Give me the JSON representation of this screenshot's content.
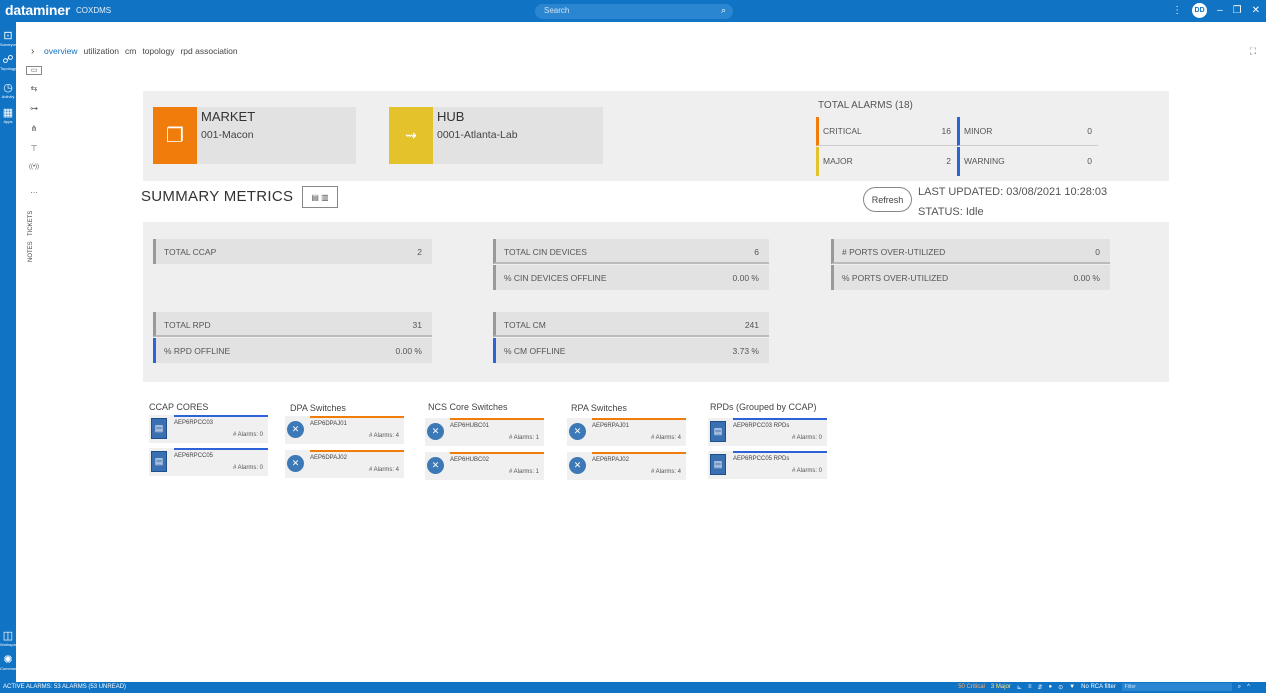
{
  "app": {
    "brand": "dataminer",
    "subtitle": "COXDMS",
    "user_initials": "DD"
  },
  "search": {
    "placeholder": "Search"
  },
  "rail": [
    {
      "label": "Surveyor",
      "icon": "surveyor-icon"
    },
    {
      "label": "Topology",
      "icon": "topology-icon"
    },
    {
      "label": "Activity",
      "icon": "activity-icon"
    },
    {
      "label": "Apps",
      "icon": "apps-icon"
    },
    {
      "label": "Workspace",
      "icon": "workspace-icon"
    },
    {
      "label": "Community",
      "icon": "community-icon"
    }
  ],
  "side_tabs": {
    "tickets": "TICKETS",
    "notes": "NOTES"
  },
  "tabs": [
    "overview",
    "utilization",
    "cm",
    "topology",
    "rpd association"
  ],
  "market": {
    "title": "MARKET",
    "value": "001-Macon"
  },
  "hub": {
    "title": "HUB",
    "value": "0001-Atlanta-Lab"
  },
  "alarms": {
    "header": "TOTAL ALARMS (18)",
    "critical": {
      "label": "CRITICAL",
      "count": "16"
    },
    "major": {
      "label": "MAJOR",
      "count": "2"
    },
    "minor": {
      "label": "MINOR",
      "count": "0"
    },
    "warning": {
      "label": "WARNING",
      "count": "0"
    }
  },
  "summary": {
    "title": "SUMMARY METRICS",
    "refresh": "Refresh",
    "last_updated": "LAST UPDATED: 03/08/2021 10:28:03",
    "status": "STATUS: Idle"
  },
  "metrics": {
    "total_ccap": {
      "label": "TOTAL CCAP",
      "value": "2"
    },
    "total_cin": {
      "label": "TOTAL CIN DEVICES",
      "value": "6"
    },
    "cin_offline": {
      "label": "% CIN DEVICES OFFLINE",
      "value": "0.00 %"
    },
    "ports_over": {
      "label": "# PORTS OVER-UTILIZED",
      "value": "0"
    },
    "ports_over_pct": {
      "label": "% PORTS OVER-UTILIZED",
      "value": "0.00 %"
    },
    "total_rpd": {
      "label": "TOTAL RPD",
      "value": "31"
    },
    "rpd_offline": {
      "label": "% RPD OFFLINE",
      "value": "0.00 %"
    },
    "total_cm": {
      "label": "TOTAL CM",
      "value": "241"
    },
    "cm_offline": {
      "label": "% CM OFFLINE",
      "value": "3.73 %"
    }
  },
  "groups": {
    "ccap": {
      "title": "CCAP CORES",
      "items": [
        {
          "name": "AEP6RPCC03",
          "alarms": "# Alarms: 0"
        },
        {
          "name": "AEP6RPCC05",
          "alarms": "# Alarms: 0"
        }
      ]
    },
    "dpa": {
      "title": "DPA Switches",
      "items": [
        {
          "name": "AEP6DPAJ01",
          "alarms": "# Alarms: 4"
        },
        {
          "name": "AEP6DPAJ02",
          "alarms": "# Alarms: 4"
        }
      ]
    },
    "ncs": {
      "title": "NCS Core Switches",
      "items": [
        {
          "name": "AEP6HUBC01",
          "alarms": "# Alarms: 1"
        },
        {
          "name": "AEP6HUBC02",
          "alarms": "# Alarms: 1"
        }
      ]
    },
    "rpa": {
      "title": "RPA Switches",
      "items": [
        {
          "name": "AEP6RPAJ01",
          "alarms": "# Alarms: 4"
        },
        {
          "name": "AEP6RPAJ02",
          "alarms": "# Alarms: 4"
        }
      ]
    },
    "rpds": {
      "title": "RPDs (Grouped by CCAP)",
      "items": [
        {
          "name": "AEP6RPCC03 RPDs",
          "alarms": "# Alarms: 0"
        },
        {
          "name": "AEP6RPCC05 RPDs",
          "alarms": "# Alarms: 0"
        }
      ]
    }
  },
  "statusbar": {
    "left": "ACTIVE ALARMS: 53 ALARMS (53 UNREAD)",
    "critical": "50 Critical",
    "major": "3 Major",
    "rca": "No RCA filter",
    "filter_placeholder": "Filter"
  },
  "colors": {
    "accent": "#1173c4",
    "market": "#f07d0b",
    "hub": "#e3c22b",
    "critical": "#f07d0b",
    "major": "#e3c22b",
    "minor": "#2e62d9",
    "warning": "#2e62d9"
  }
}
